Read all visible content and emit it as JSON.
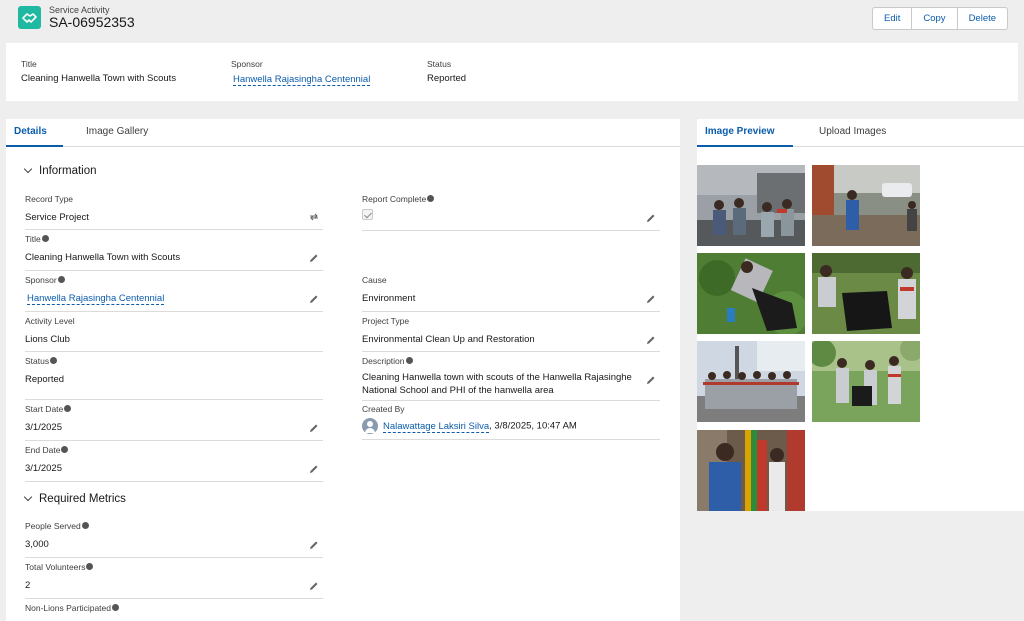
{
  "header": {
    "object_type": "Service Activity",
    "record_name": "SA-06952353",
    "icon": "handshake-icon",
    "icon_color": "#1fb8a0",
    "actions": [
      "Edit",
      "Copy",
      "Delete"
    ]
  },
  "highlights": {
    "title_label": "Title",
    "title_value": "Cleaning Hanwella Town with Scouts",
    "sponsor_label": "Sponsor",
    "sponsor_value": "Hanwella Rajasingha Centennial",
    "status_label": "Status",
    "status_value": "Reported"
  },
  "left_tabs": [
    "Details",
    "Image Gallery"
  ],
  "sections": {
    "information": "Information",
    "required_metrics": "Required Metrics"
  },
  "fields": {
    "record_type": {
      "label": "Record Type",
      "value": "Service Project"
    },
    "title": {
      "label": "Title",
      "value": "Cleaning Hanwella Town with Scouts"
    },
    "sponsor": {
      "label": "Sponsor",
      "value": "Hanwella Rajasingha Centennial"
    },
    "activity_level": {
      "label": "Activity Level",
      "value": "Lions Club"
    },
    "status": {
      "label": "Status",
      "value": "Reported"
    },
    "start_date": {
      "label": "Start Date",
      "value": "3/1/2025"
    },
    "end_date": {
      "label": "End Date",
      "value": "3/1/2025"
    },
    "report_complete": {
      "label": "Report Complete",
      "checked": true
    },
    "cause": {
      "label": "Cause",
      "value": "Environment"
    },
    "project_type": {
      "label": "Project Type",
      "value": "Environmental Clean Up and Restoration"
    },
    "description": {
      "label": "Description",
      "value_line1": "Cleaning Hanwella town with scouts of the Hanwella Rajasinghe",
      "value_line2": "National School and PHI of the hanwella area"
    },
    "created_by": {
      "label": "Created By",
      "user": "Nalawattage Laksiri Silva",
      "datetime": ", 3/8/2025, 10:47 AM"
    },
    "people_served": {
      "label": "People Served",
      "value": "3,000"
    },
    "total_volunteers": {
      "label": "Total Volunteers",
      "value": "2"
    },
    "non_lions": {
      "label": "Non-Lions Participated"
    }
  },
  "right_tabs": [
    "Image Preview",
    "Upload Images"
  ],
  "colors": {
    "brand": "#0b5cab",
    "accent": "#1fb8a0",
    "background": "#eeeeee"
  }
}
